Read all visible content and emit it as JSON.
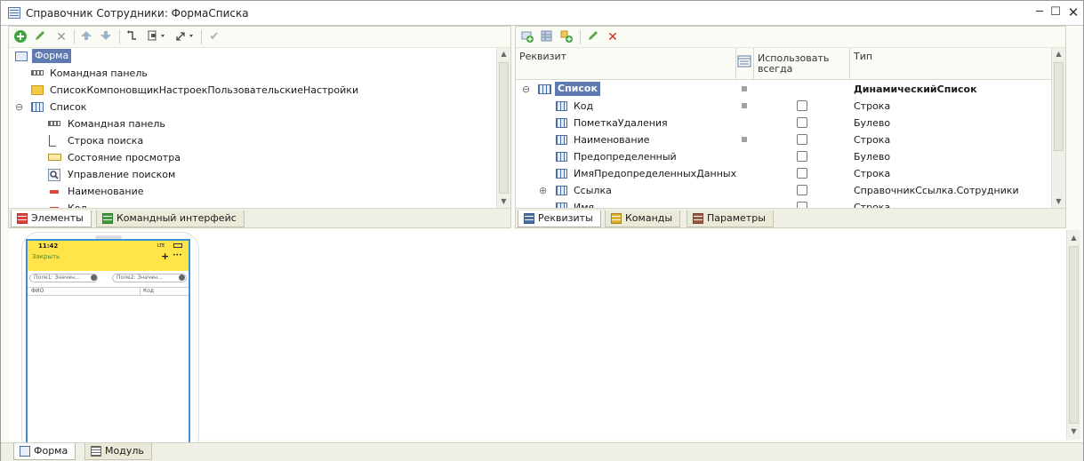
{
  "window": {
    "title": "Справочник Сотрудники: ФормаСписка",
    "controls": [
      "minimize-icon",
      "maximize-icon",
      "close-icon"
    ]
  },
  "left_panel": {
    "toolbar_icons": [
      "add-icon",
      "edit-icon",
      "delete-icon",
      "move-up-icon",
      "move-down-icon",
      "level-up-icon",
      "add-group-dropdown-icon",
      "expand-dropdown-icon",
      "check-icon"
    ],
    "tree": [
      {
        "label": "Форма",
        "level": 0,
        "icon": "form-icon",
        "selected": true
      },
      {
        "label": "Командная панель",
        "level": 1,
        "icon": "command-panel-icon"
      },
      {
        "label": "СписокКомпоновщикНастроекПользовательскиеНастройки",
        "level": 1,
        "icon": "folder-icon"
      },
      {
        "label": "Список",
        "level": 0,
        "icon": "table-icon",
        "expanded": true
      },
      {
        "label": "Командная панель",
        "level": 2,
        "icon": "command-panel-icon"
      },
      {
        "label": "Строка поиска",
        "level": 2,
        "icon": "search-string-icon"
      },
      {
        "label": "Состояние просмотра",
        "level": 2,
        "icon": "view-state-icon"
      },
      {
        "label": "Управление поиском",
        "level": 2,
        "icon": "search-control-icon"
      },
      {
        "label": "Наименование",
        "level": 2,
        "icon": "field-icon"
      },
      {
        "label": "Код",
        "level": 2,
        "icon": "field-icon"
      }
    ],
    "tabs": [
      {
        "label": "Элементы",
        "active": true,
        "icon": "elements-icon"
      },
      {
        "label": "Командный интерфейс",
        "active": false,
        "icon": "command-interface-icon"
      }
    ]
  },
  "right_panel": {
    "toolbar_icons": [
      "add-attribute-icon",
      "add-table-icon",
      "add-column-icon",
      "edit-icon",
      "delete-icon"
    ],
    "columns": {
      "rekvizit": "Реквизит",
      "use_always": "Использовать всегда",
      "type": "Тип"
    },
    "rows": [
      {
        "name": "Список",
        "bold": true,
        "selected": true,
        "expander": "⊖",
        "sq": true,
        "checkbox": false,
        "type": "ДинамическийСписок"
      },
      {
        "name": "Код",
        "sq": true,
        "checkbox": true,
        "type": "Строка"
      },
      {
        "name": "ПометкаУдаления",
        "sq": false,
        "checkbox": true,
        "type": "Булево"
      },
      {
        "name": "Наименование",
        "sq": true,
        "checkbox": true,
        "type": "Строка"
      },
      {
        "name": "Предопределенный",
        "sq": false,
        "checkbox": true,
        "type": "Булево"
      },
      {
        "name": "ИмяПредопределенныхДанных",
        "sq": false,
        "checkbox": true,
        "type": "Строка"
      },
      {
        "name": "Ссылка",
        "expander": "⊕",
        "sq": false,
        "checkbox": true,
        "type": "СправочникСсылка.Сотрудники"
      },
      {
        "name": "Имя",
        "sq": false,
        "checkbox": true,
        "type": "Строка"
      }
    ],
    "tabs": [
      {
        "label": "Реквизиты",
        "active": true,
        "icon": "attributes-icon"
      },
      {
        "label": "Команды",
        "active": false,
        "icon": "commands-icon"
      },
      {
        "label": "Параметры",
        "active": false,
        "icon": "parameters-icon"
      }
    ]
  },
  "preview": {
    "time": "11:42",
    "signal": "LTE",
    "close_label": "Закрыть",
    "plus": "+",
    "more": "•••",
    "filter1": "Поле1: Значен...",
    "filter2": "Поле2: Значен...",
    "col_fio": "ФИО",
    "col_kod": "Код"
  },
  "bottom_tabs": [
    {
      "label": "Форма",
      "active": true,
      "icon": "form-tab-icon"
    },
    {
      "label": "Модуль",
      "active": false,
      "icon": "module-icon"
    }
  ]
}
